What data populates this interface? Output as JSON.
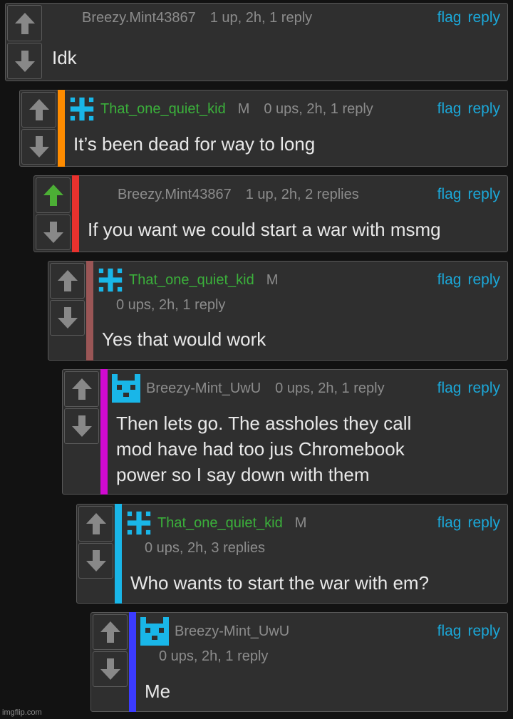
{
  "actions": {
    "flag": "flag",
    "reply": "reply"
  },
  "mod_badge": "M",
  "colors": {
    "link": "#1ba8d9",
    "username_green": "#3bb03b",
    "upvoted_green": "#4caf35",
    "avatar_blue": "#19b6e8"
  },
  "comments": [
    {
      "username": "Breezy.Mint43867",
      "stats": "1 up, 2h, 1 reply",
      "text": "Idk",
      "bar_color": "",
      "upvoted": false
    },
    {
      "username": "That_one_quiet_kid",
      "mod": true,
      "avatar": "plus-icon",
      "stats": "0 ups, 2h, 1 reply",
      "text": "It’s been dead for way to long",
      "bar_color": "#ff8c00",
      "upvoted": false
    },
    {
      "username": "Breezy.Mint43867",
      "stats": "1 up, 2h, 2 replies",
      "text": "If you want we could start a war with msmg",
      "bar_color": "#e8322e",
      "upvoted": true
    },
    {
      "username": "That_one_quiet_kid",
      "mod": true,
      "avatar": "plus-icon",
      "stats": "0 ups, 2h, 1 reply",
      "text": "Yes that would work",
      "bar_color": "#9a5656",
      "upvoted": false
    },
    {
      "username": "Breezy-Mint_UwU",
      "avatar": "cat-icon",
      "stats": "0 ups, 2h, 1 reply",
      "text_lines": [
        "Then lets go. The assholes they call",
        "mod have had too jus Chromebook",
        "power so I say down with them"
      ],
      "bar_color": "#d00ad0",
      "upvoted": false
    },
    {
      "username": "That_one_quiet_kid",
      "mod": true,
      "avatar": "plus-icon",
      "stats": "0 ups, 2h, 3 replies",
      "text": "Who wants to start the war with em?",
      "bar_color": "#19b6e8",
      "upvoted": false
    },
    {
      "username": "Breezy-Mint_UwU",
      "avatar": "cat-icon",
      "stats": "0 ups, 2h, 1 reply",
      "text": "Me",
      "bar_color": "#3b3bff",
      "upvoted": false
    }
  ],
  "watermark": "imgflip.com"
}
